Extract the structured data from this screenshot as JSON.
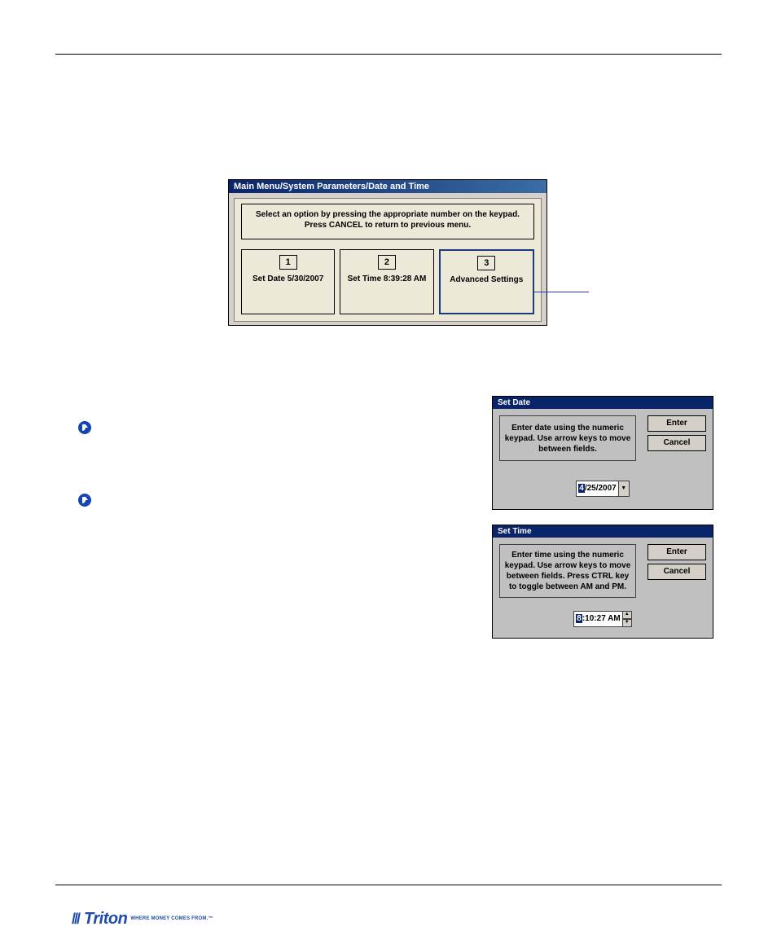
{
  "main_menu": {
    "titlebar": "Main Menu/System Parameters/Date and Time",
    "instruction_line1": "Select an option by pressing the appropriate number on the keypad.",
    "instruction_line2": "Press CANCEL to return to previous menu.",
    "options": [
      {
        "key": "1",
        "label": "Set Date 5/30/2007"
      },
      {
        "key": "2",
        "label": "Set Time 8:39:28 AM"
      },
      {
        "key": "3",
        "label": "Advanced Settings"
      }
    ]
  },
  "set_date": {
    "titlebar": "Set Date",
    "msg": "Enter date using the numeric keypad.  Use arrow keys to move between fields.",
    "enter": "Enter",
    "cancel": "Cancel",
    "value_sel": "4",
    "value_rest": "/25/2007"
  },
  "set_time": {
    "titlebar": "Set Time",
    "msg": "Enter time using the numeric keypad.  Use arrow keys to move between fields.  Press CTRL key to toggle between AM and PM.",
    "enter": "Enter",
    "cancel": "Cancel",
    "value_sel": "8",
    "value_rest": ":10:27 AM"
  },
  "footer": {
    "brand": "Triton",
    "tagline": "WHERE MONEY COMES FROM.™"
  }
}
